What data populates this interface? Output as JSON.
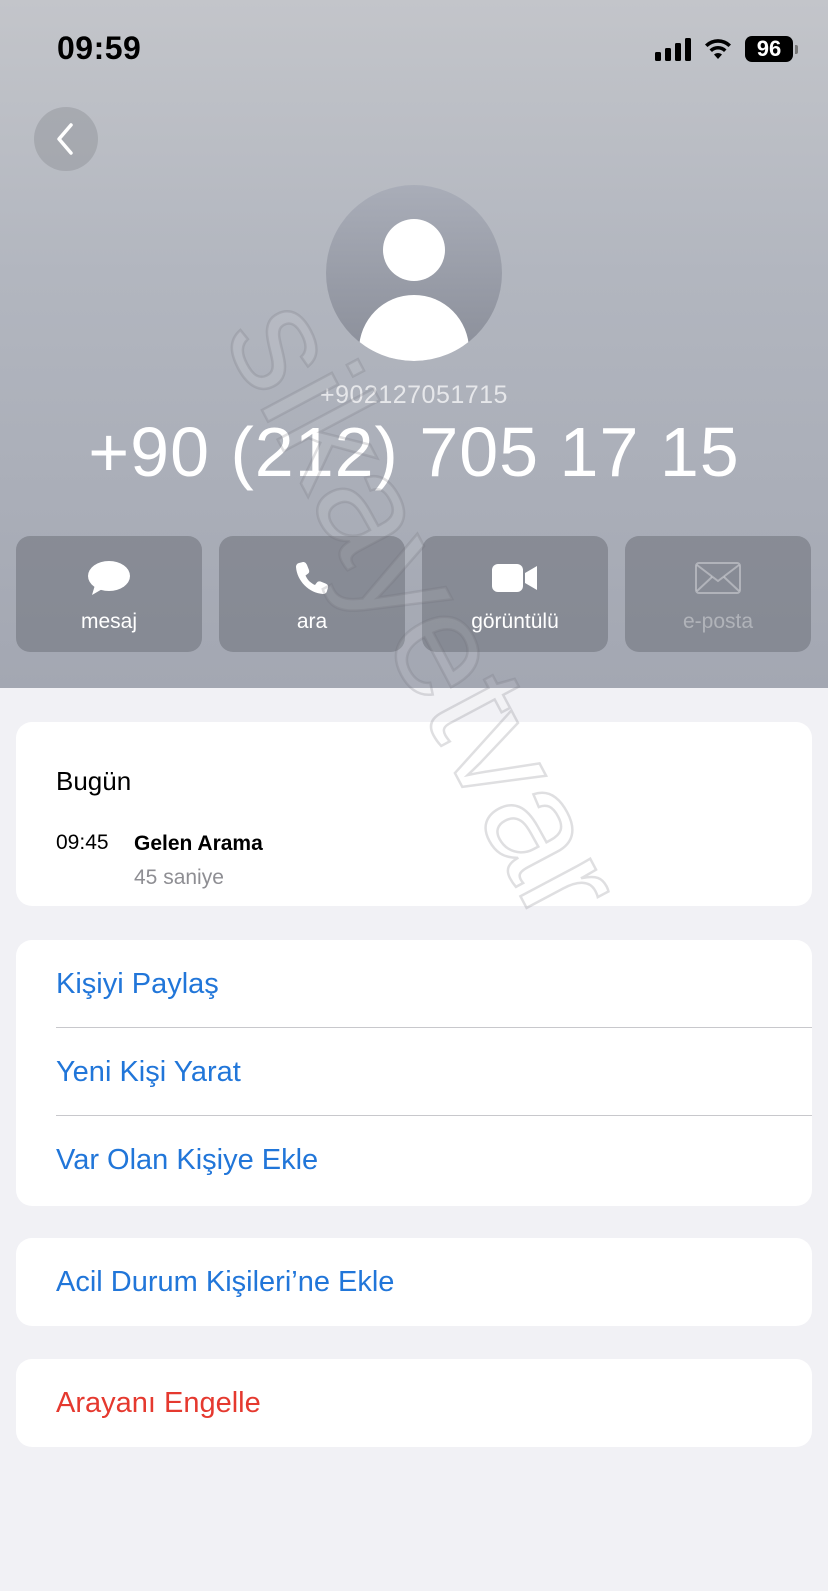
{
  "status_bar": {
    "time": "09:59",
    "battery": "96",
    "icons": [
      "signal-icon",
      "wifi-icon",
      "battery-icon"
    ]
  },
  "nav": {
    "back_icon": "chevron-left-icon"
  },
  "contact": {
    "raw_number": "+902127051715",
    "formatted_number": "+90 (212) 705 17 15"
  },
  "actions": [
    {
      "label": "mesaj",
      "icon": "message-bubble-icon",
      "enabled": true
    },
    {
      "label": "ara",
      "icon": "phone-icon",
      "enabled": true
    },
    {
      "label": "görüntülü",
      "icon": "video-camera-icon",
      "enabled": true
    },
    {
      "label": "e-posta",
      "icon": "envelope-icon",
      "enabled": false
    }
  ],
  "recents": {
    "date": "Bugün",
    "time": "09:45",
    "type": "Gelen Arama",
    "duration": "45 saniye"
  },
  "options": [
    {
      "label": "Kişiyi Paylaş"
    },
    {
      "label": "Yeni Kişi Yarat"
    },
    {
      "label": "Var Olan Kişiye Ekle"
    }
  ],
  "emergency": {
    "label": "Acil Durum Kişileri’ne Ekle"
  },
  "block": {
    "label": "Arayanı Engelle"
  },
  "colors": {
    "link_blue": "#2176d9",
    "destructive_red": "#e5392f",
    "background": "#f1f1f5"
  },
  "watermark": {
    "text": "sikayetvar"
  }
}
